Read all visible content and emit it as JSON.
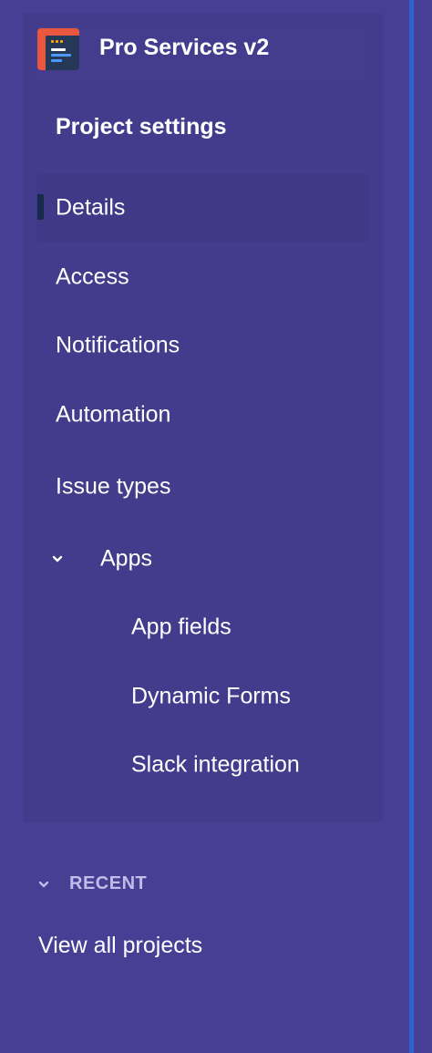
{
  "project": {
    "name": "Pro Services v2",
    "icon": "project-board-icon"
  },
  "settings": {
    "title": "Project settings",
    "items": [
      {
        "label": "Details",
        "active": true
      },
      {
        "label": "Access"
      },
      {
        "label": "Notifications"
      },
      {
        "label": "Automation"
      },
      {
        "label": "Issue types"
      }
    ],
    "apps": {
      "label": "Apps",
      "expanded": true,
      "items": [
        {
          "label": "App fields"
        },
        {
          "label": "Dynamic Forms"
        },
        {
          "label": "Slack integration"
        }
      ]
    }
  },
  "recent": {
    "label": "RECENT",
    "expanded": true
  },
  "view_all_label": "View all projects",
  "colors": {
    "sidebar_bg": "#463f94",
    "panel_bg": "#433c8c",
    "active_bg": "#3f3987",
    "active_indicator": "#172b4d",
    "project_icon": "#e9573f",
    "divider": "#2f5fd0",
    "recent_text": "#c1bde8"
  }
}
